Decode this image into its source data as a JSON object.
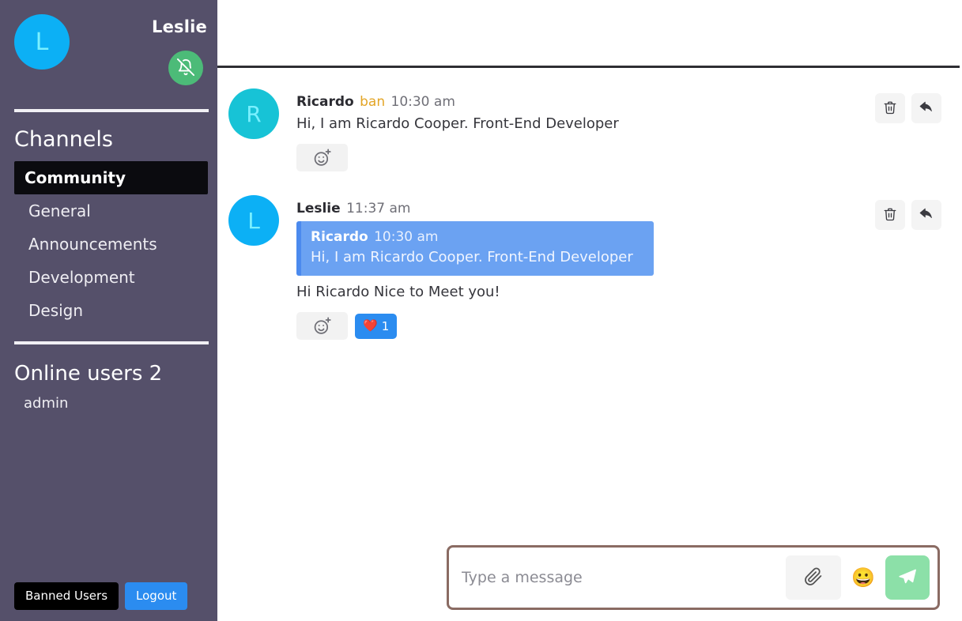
{
  "sidebar": {
    "user": {
      "avatar_initial": "L",
      "name": "Leslie",
      "avatar_color": "#0cb0f5"
    },
    "mute_button": {
      "icon": "bell-off-icon",
      "color": "#4cbb78"
    },
    "channels_title": "Channels",
    "channels": [
      {
        "label": "Community",
        "active": true
      },
      {
        "label": "General",
        "active": false
      },
      {
        "label": "Announcements",
        "active": false
      },
      {
        "label": "Development",
        "active": false
      },
      {
        "label": "Design",
        "active": false
      }
    ],
    "online_title": "Online users 2",
    "online_users": [
      {
        "name": "admin"
      }
    ],
    "footer": {
      "banned_label": "Banned Users",
      "logout_label": "Logout",
      "banned_color": "#000000",
      "logout_color": "#2b8cf0"
    }
  },
  "messages": [
    {
      "avatar_initial": "R",
      "avatar_color": "#17c3d6",
      "author": "Ricardo",
      "ban_label": "ban",
      "time": "10:30 am",
      "text": "Hi, I am Ricardo Cooper. Front-End Developer",
      "quote": null,
      "reactions": [],
      "add_reaction_icon": "add-reaction-icon",
      "actions": {
        "delete_icon": "trash-icon",
        "reply_icon": "reply-icon"
      }
    },
    {
      "avatar_initial": "L",
      "avatar_color": "#0cb0f5",
      "author": "Leslie",
      "ban_label": "",
      "time": "11:37 am",
      "text": "Hi Ricardo Nice to Meet you!",
      "quote": {
        "author": "Ricardo",
        "time": "10:30 am",
        "text": "Hi, I am Ricardo Cooper. Front-End Developer",
        "color": "#6ba2f2"
      },
      "reactions": [
        {
          "emoji": "❤️",
          "count": "1",
          "color": "#2b8cf0"
        }
      ],
      "add_reaction_icon": "add-reaction-icon",
      "actions": {
        "delete_icon": "trash-icon",
        "reply_icon": "reply-icon"
      }
    }
  ],
  "composer": {
    "placeholder": "Type a message",
    "value": "",
    "attach_icon": "paperclip-icon",
    "emoji_icon": "emoji-icon",
    "emoji_glyph": "😀",
    "send_icon": "send-icon",
    "send_color": "#8ce0a8",
    "border_color": "#8a6b63"
  }
}
